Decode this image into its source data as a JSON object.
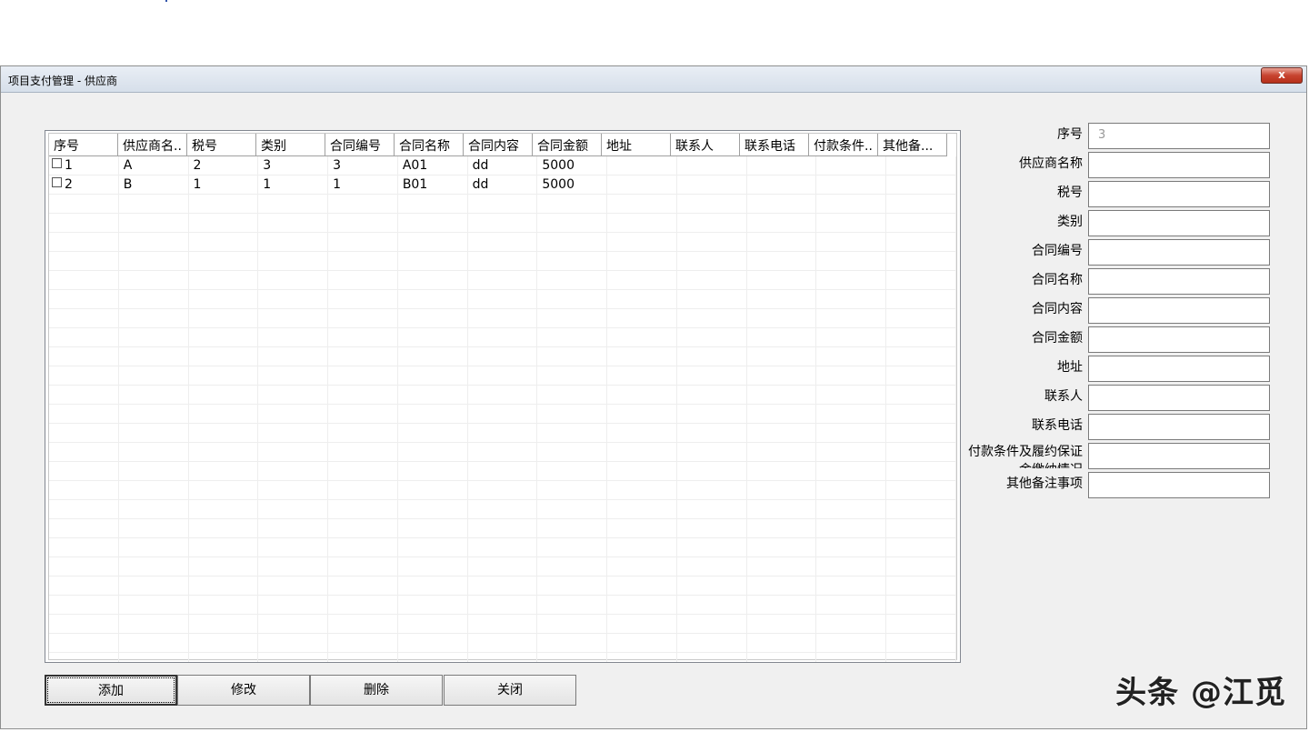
{
  "window": {
    "title": "项目支付管理 - 供应商",
    "close_label": "x"
  },
  "grid": {
    "columns": [
      "序号",
      "供应商名..",
      "税号",
      "类别",
      "合同编号",
      "合同名称",
      "合同内容",
      "合同金额",
      "地址",
      "联系人",
      "联系电话",
      "付款条件..",
      "其他备..."
    ],
    "rows": [
      [
        "1",
        "A",
        "2",
        "3",
        "3",
        "A01",
        "dd",
        "5000",
        "",
        "",
        "",
        "",
        ""
      ],
      [
        "2",
        "B",
        "1",
        "1",
        "1",
        "B01",
        "dd",
        "5000",
        "",
        "",
        "",
        "",
        ""
      ]
    ]
  },
  "form": {
    "fields": [
      {
        "label": "序号",
        "value": "3"
      },
      {
        "label": "供应商名称",
        "value": ""
      },
      {
        "label": "税号",
        "value": ""
      },
      {
        "label": "类别",
        "value": ""
      },
      {
        "label": "合同编号",
        "value": ""
      },
      {
        "label": "合同名称",
        "value": ""
      },
      {
        "label": "合同内容",
        "value": ""
      },
      {
        "label": "合同金额",
        "value": ""
      },
      {
        "label": "地址",
        "value": ""
      },
      {
        "label": "联系人",
        "value": ""
      },
      {
        "label": "联系电话",
        "value": ""
      },
      {
        "label": "付款条件及履约保证金缴纳情况",
        "value": ""
      },
      {
        "label": "其他备注事项",
        "value": ""
      }
    ]
  },
  "buttons": {
    "add": "添加",
    "edit": "修改",
    "delete": "删除",
    "close": "关闭"
  },
  "watermark": "头条 @江觅"
}
